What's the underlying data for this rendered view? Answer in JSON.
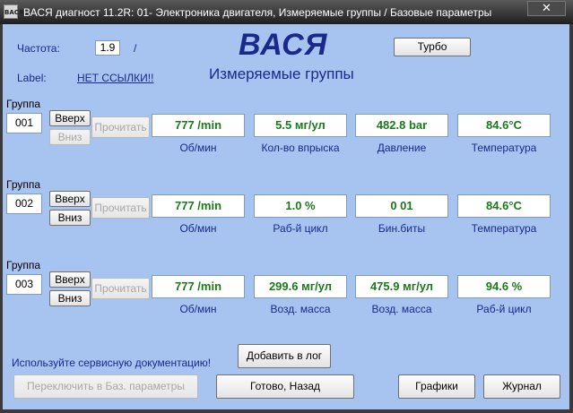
{
  "window": {
    "icon_text": "ВАСЯ",
    "title": "ВАСЯ диагност 11.2R: 01- Электроника двигателя,  Измеряемые группы / Базовые параметры",
    "close_label": "✕"
  },
  "header": {
    "freq_label": "Частота:",
    "freq_value": "1.9",
    "freq_sep": "/",
    "label_label": "Label:",
    "label_link": "НЕТ ССЫЛКИ!!",
    "app_name": "ВАСЯ",
    "subtitle": "Измеряемые группы",
    "turbo_button": "Турбо"
  },
  "groups": [
    {
      "label": "Группа",
      "number": "001",
      "up": "Вверх",
      "down": "Вниз",
      "read": "Прочитать",
      "fields": [
        {
          "value": "777 /min",
          "caption": "Об/мин"
        },
        {
          "value": "5.5 мг/ул",
          "caption": "Кол-во впрыска"
        },
        {
          "value": "482.8 bar",
          "caption": "Давление"
        },
        {
          "value": "84.6°C",
          "caption": "Температура"
        }
      ]
    },
    {
      "label": "Группа",
      "number": "002",
      "up": "Вверх",
      "down": "Вниз",
      "read": "Прочитать",
      "fields": [
        {
          "value": "777 /min",
          "caption": "Об/мин"
        },
        {
          "value": "1.0 %",
          "caption": "Раб-й цикл"
        },
        {
          "value": "0 01",
          "caption": "Бин.биты"
        },
        {
          "value": "84.6°C",
          "caption": "Температура"
        }
      ]
    },
    {
      "label": "Группа",
      "number": "003",
      "up": "Вверх",
      "down": "Вниз",
      "read": "Прочитать",
      "fields": [
        {
          "value": "777 /min",
          "caption": "Об/мин"
        },
        {
          "value": "299.6 мг/ул",
          "caption": "Возд. масса"
        },
        {
          "value": "475.9 мг/ул",
          "caption": "Возд. масса"
        },
        {
          "value": "94.6 %",
          "caption": "Раб-й цикл"
        }
      ]
    }
  ],
  "footer": {
    "doc_hint": "Используйте сервисную документацию!",
    "add_log": "Добавить в лог",
    "switch_basic": "Переключить в Баз. параметры",
    "done_back": "Готово, Назад",
    "graphs": "Графики",
    "journal": "Журнал"
  },
  "colors": {
    "background": "#a7c3ef",
    "label_text": "#1a2a8a",
    "value_text": "#1a7a1a"
  }
}
